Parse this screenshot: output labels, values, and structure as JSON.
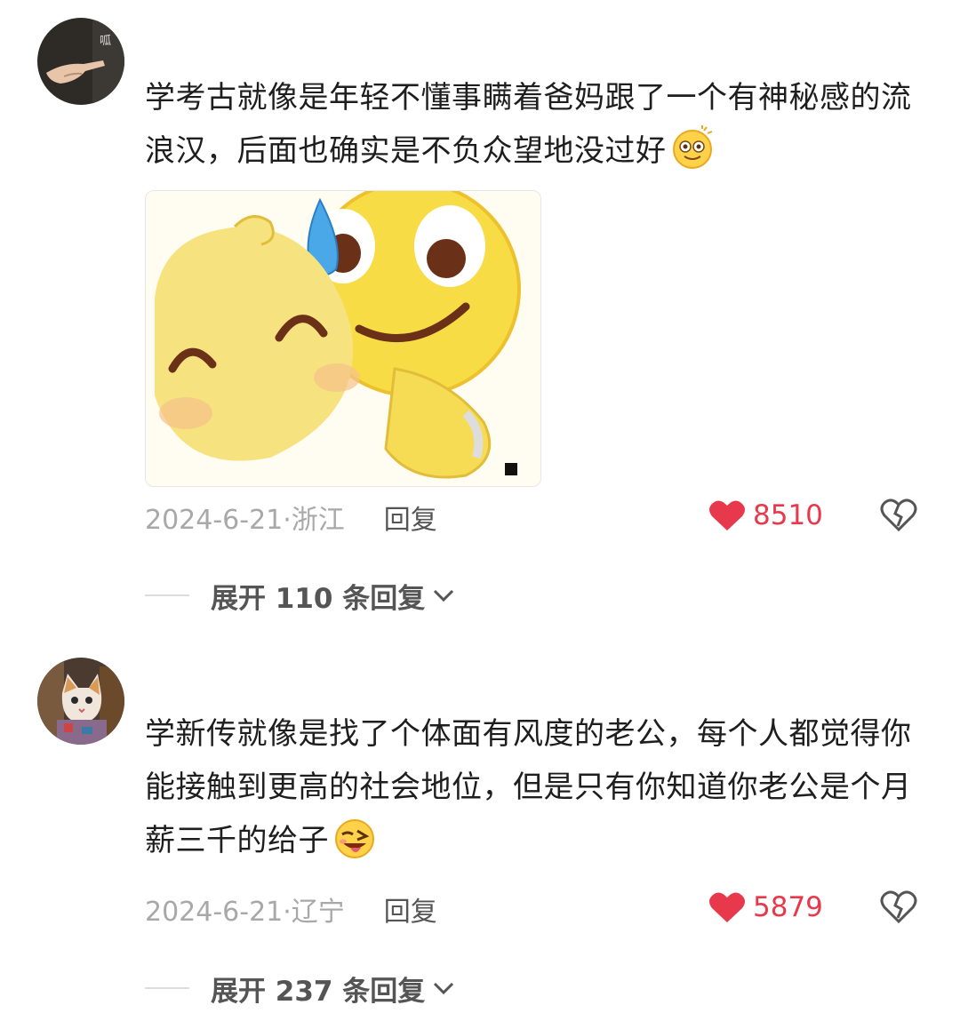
{
  "comments": [
    {
      "avatar_icon": "pointing-hand-avatar",
      "avatar_text": "呱",
      "text": "学考古就像是年轻不懂事瞒着爸妈跟了一个有神秘感的流浪汉，后面也确实是不负众望地没过好",
      "inline_emoji": "dizzy-smile-emoji",
      "sticker": "sweat-hug-sticker",
      "date": "2024-6-21·",
      "location": "浙江",
      "reply_label": "回复",
      "likes": "8510",
      "expand_label": "展开 110 条回复"
    },
    {
      "avatar_icon": "cat-avatar",
      "text": "学新传就像是找了个体面有风度的老公，每个人都觉得你能接触到更高的社会地位，但是只有你知道你老公是个月薪三千的给子",
      "inline_emoji": "wink-tongue-emoji",
      "date": "2024-6-21·",
      "location": "辽宁",
      "reply_label": "回复",
      "likes": "5879",
      "expand_label": "展开 237 条回复"
    }
  ],
  "colors": {
    "like": "#e8394c",
    "meta": "#a8a8a8",
    "text": "#1e1e1e"
  }
}
